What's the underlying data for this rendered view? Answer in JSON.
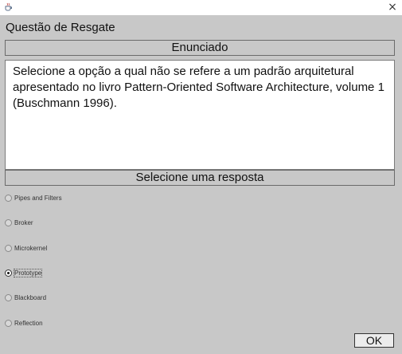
{
  "titlebar": {
    "icon": "java-cup-icon",
    "close_label": "×"
  },
  "window": {
    "title": "Questão de Resgate"
  },
  "statement": {
    "header": "Enunciado",
    "text": "Selecione a opção a qual não se refere a um padrão arquitetural apresentado no livro Pattern-Oriented Software Architecture, volume 1 (Buschmann 1996)."
  },
  "answers": {
    "header": "Selecione uma resposta",
    "options": [
      {
        "label": "Pipes and Filters",
        "selected": false
      },
      {
        "label": "Broker",
        "selected": false
      },
      {
        "label": "Microkernel",
        "selected": false
      },
      {
        "label": "Prototype",
        "selected": true
      },
      {
        "label": "Blackboard",
        "selected": false
      },
      {
        "label": "Reflection",
        "selected": false
      }
    ]
  },
  "actions": {
    "ok_label": "OK"
  },
  "colors": {
    "panel": "#c8c8c8",
    "statement_bg": "#ffffff"
  }
}
